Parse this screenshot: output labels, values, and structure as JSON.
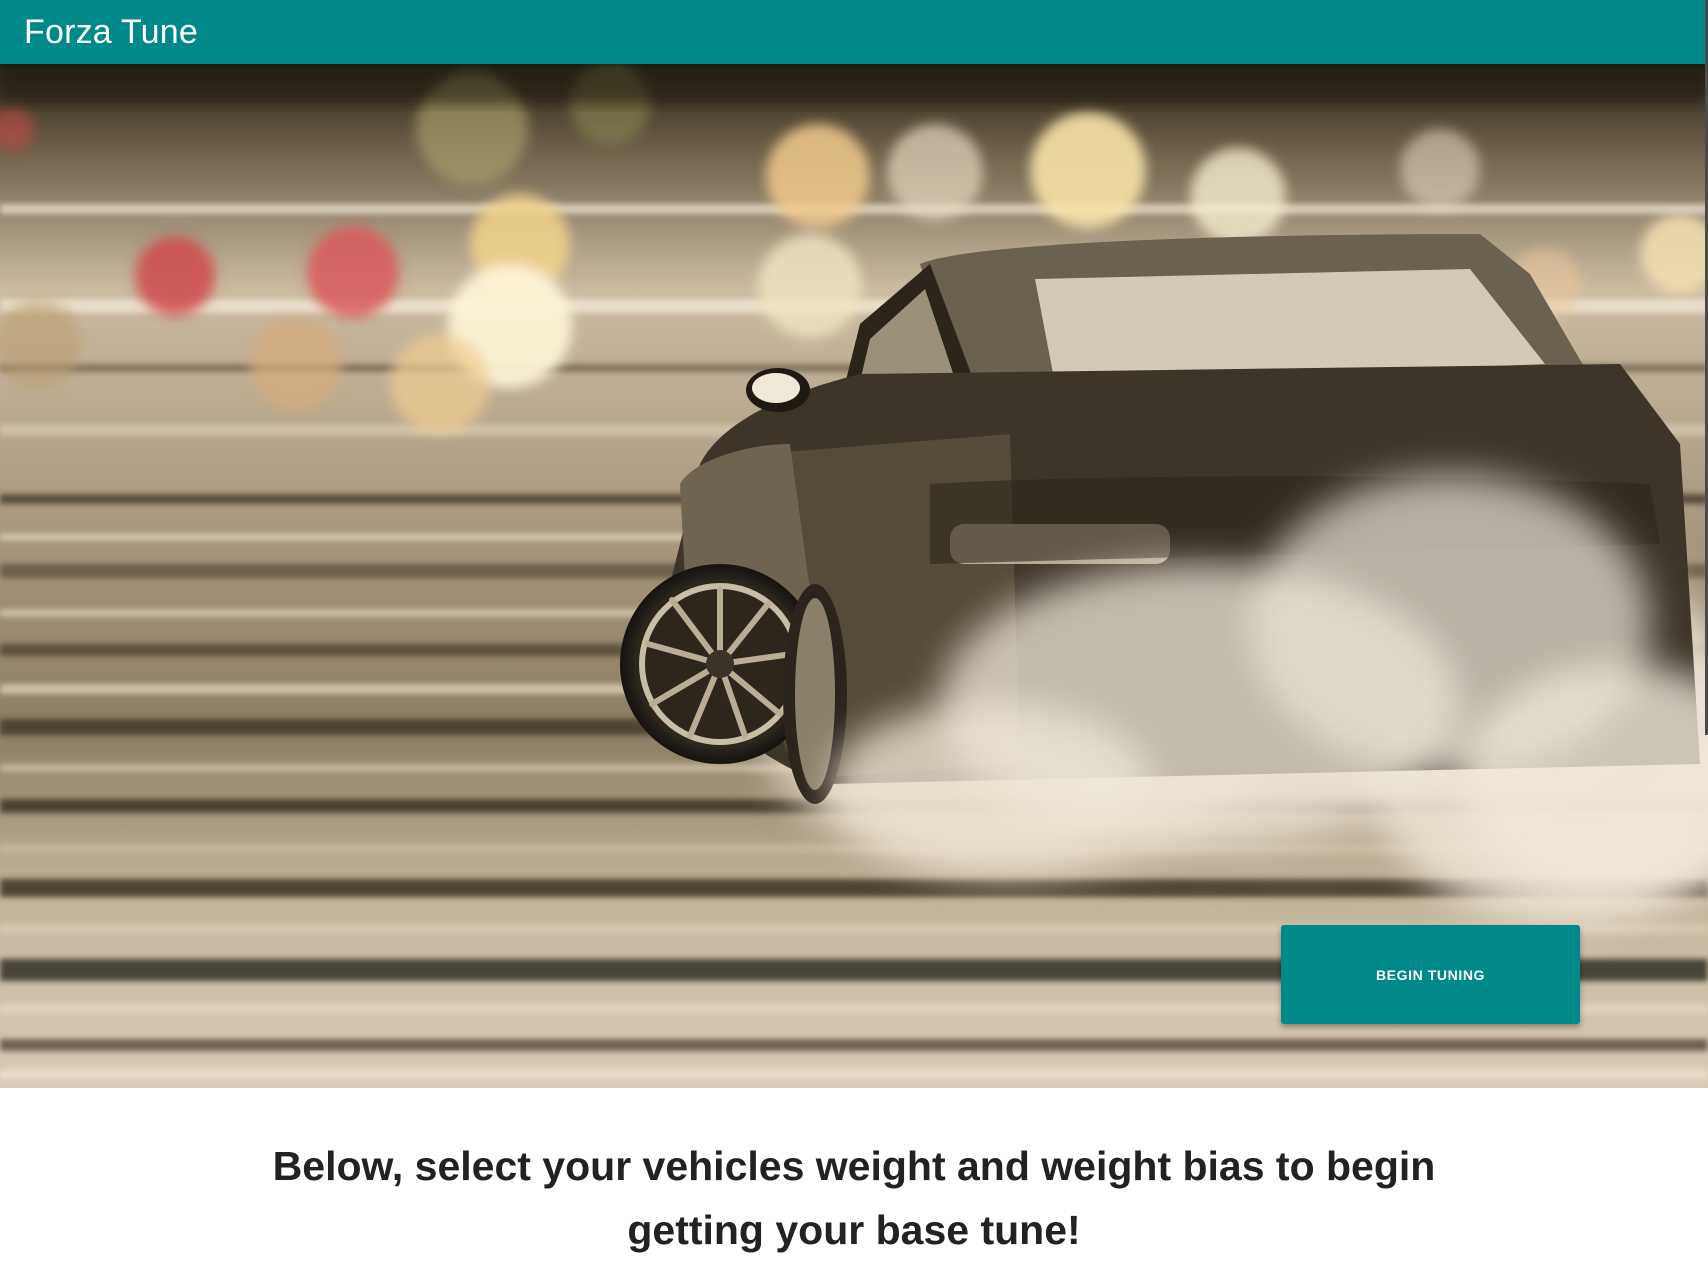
{
  "app": {
    "title": "Forza Tune"
  },
  "hero": {
    "begin_button_label": "BEGIN TUNING"
  },
  "intro": {
    "heading": "Below, select your vehicles weight and weight bias to begin getting your base tune!"
  },
  "colors": {
    "primary": "#00898a",
    "heading_text": "#222222",
    "background": "#ffffff"
  }
}
